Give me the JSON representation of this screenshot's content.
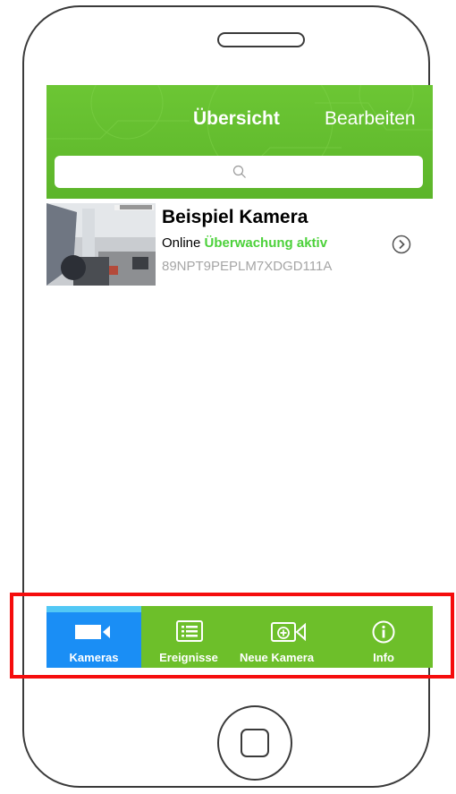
{
  "navbar": {
    "title": "Übersicht",
    "edit_label": "Bearbeiten",
    "background_color": "#62bb2e"
  },
  "search": {
    "placeholder": "",
    "icon": "search-icon"
  },
  "camera_list": [
    {
      "name": "Beispiel Kamera",
      "status_online": "Online",
      "status_monitoring": "Überwachung aktiv",
      "device_id": "89NPT9PEPLM7XDGD111A",
      "monitoring_color": "#4cd13a",
      "action_icon": "chevron-right-circle-icon"
    }
  ],
  "tabbar": {
    "background_color": "#6dbf2a",
    "active_color": "#1a8ef5",
    "tabs": [
      {
        "label": "Kameras",
        "icon": "video-camera-icon",
        "active": true
      },
      {
        "label": "Ereignisse",
        "icon": "list-icon",
        "active": false
      },
      {
        "label": "Neue Kamera",
        "icon": "add-camera-icon",
        "active": false
      },
      {
        "label": "Info",
        "icon": "info-icon",
        "active": false
      }
    ]
  },
  "annotation": {
    "highlight_color": "#f50d0d"
  }
}
